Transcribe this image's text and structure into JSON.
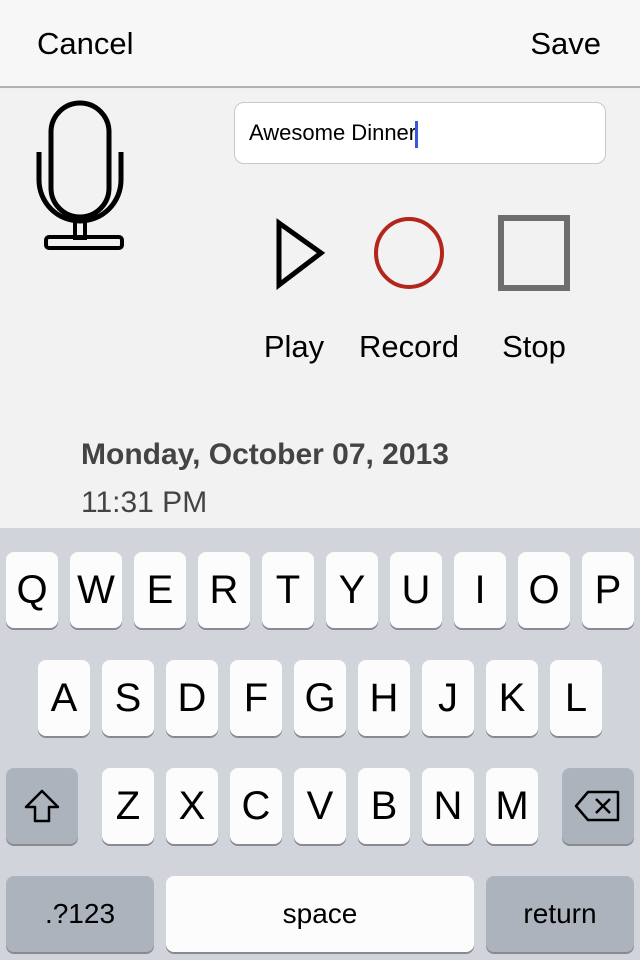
{
  "nav": {
    "cancel": "Cancel",
    "save": "Save"
  },
  "title_field": {
    "value": "Awesome Dinner"
  },
  "controls": {
    "play": "Play",
    "record": "Record",
    "stop": "Stop"
  },
  "date": "Monday, October 07, 2013",
  "time": "11:31 PM",
  "keyboard": {
    "row1": [
      "Q",
      "W",
      "E",
      "R",
      "T",
      "Y",
      "U",
      "I",
      "O",
      "P"
    ],
    "row2": [
      "A",
      "S",
      "D",
      "F",
      "G",
      "H",
      "J",
      "K",
      "L"
    ],
    "row3": [
      "Z",
      "X",
      "C",
      "V",
      "B",
      "N",
      "M"
    ],
    "numbers": ".?123",
    "space": "space",
    "return": "return"
  },
  "colors": {
    "record": "#b3261e",
    "stop": "#6e6e6e",
    "caret": "#3a55e0"
  }
}
